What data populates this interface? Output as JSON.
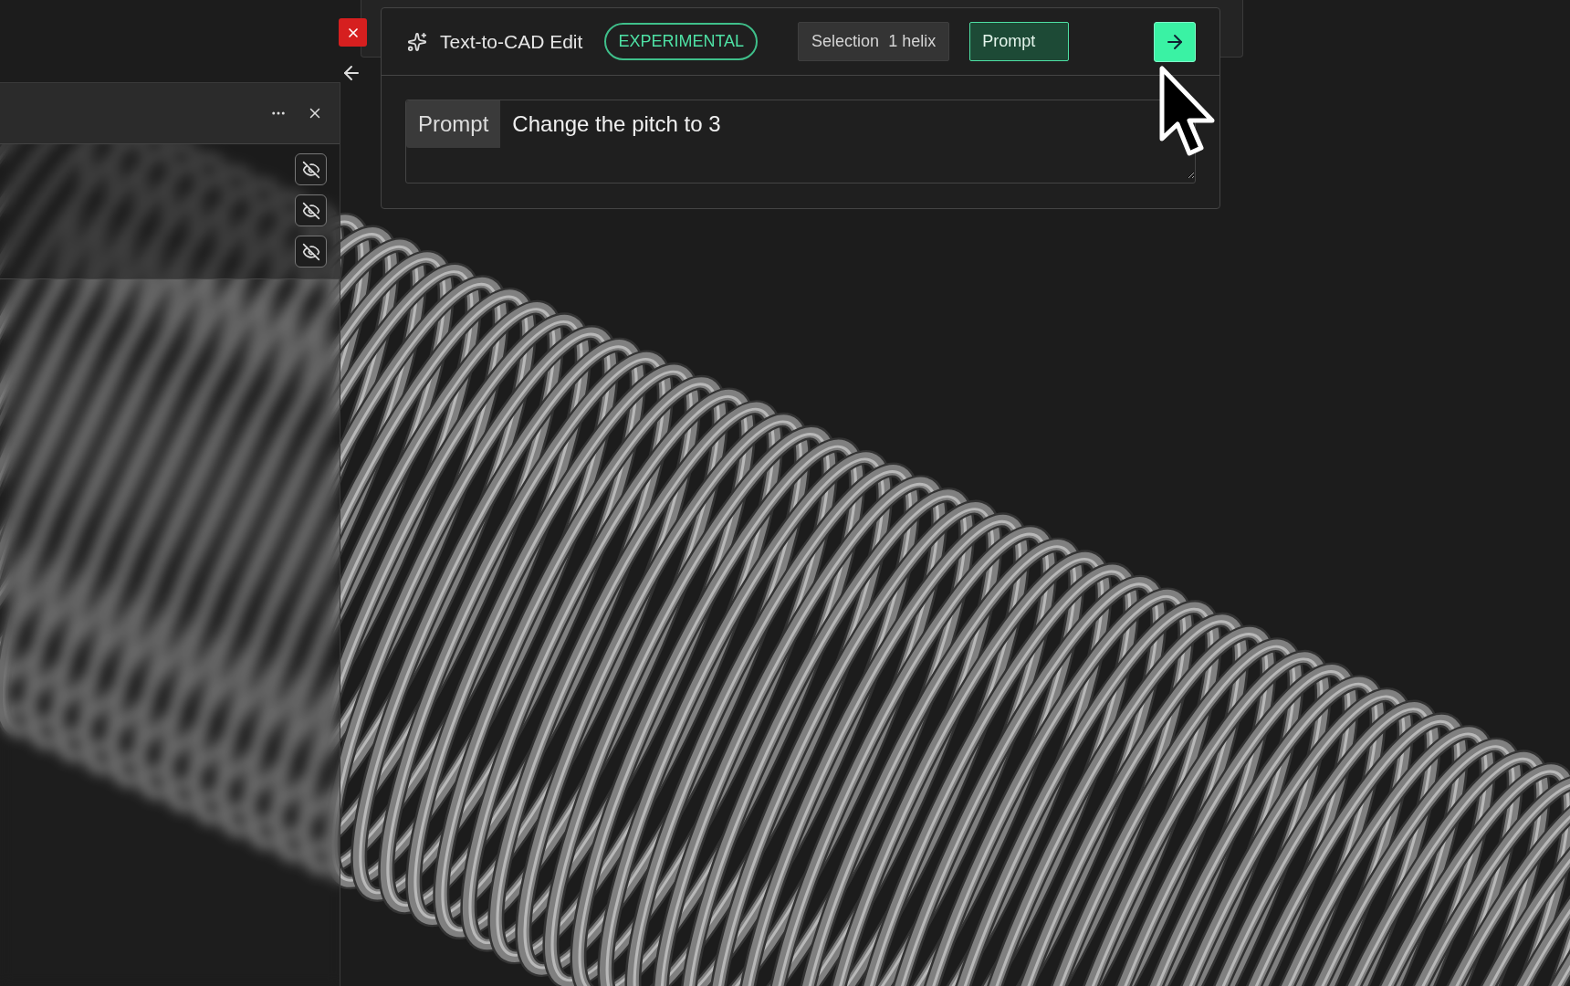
{
  "dialog": {
    "title": "Text-to-CAD Edit",
    "badge": "EXPERIMENTAL",
    "selection": {
      "label": "Selection",
      "value": "1 helix"
    },
    "mode_toggle": {
      "label": "Prompt",
      "selected": true
    },
    "prompt": {
      "label": "Prompt",
      "value": "Change the pitch to 3"
    }
  },
  "side_panel": {
    "layers": [
      {
        "visible": false
      },
      {
        "visible": false
      },
      {
        "visible": false
      }
    ]
  }
}
